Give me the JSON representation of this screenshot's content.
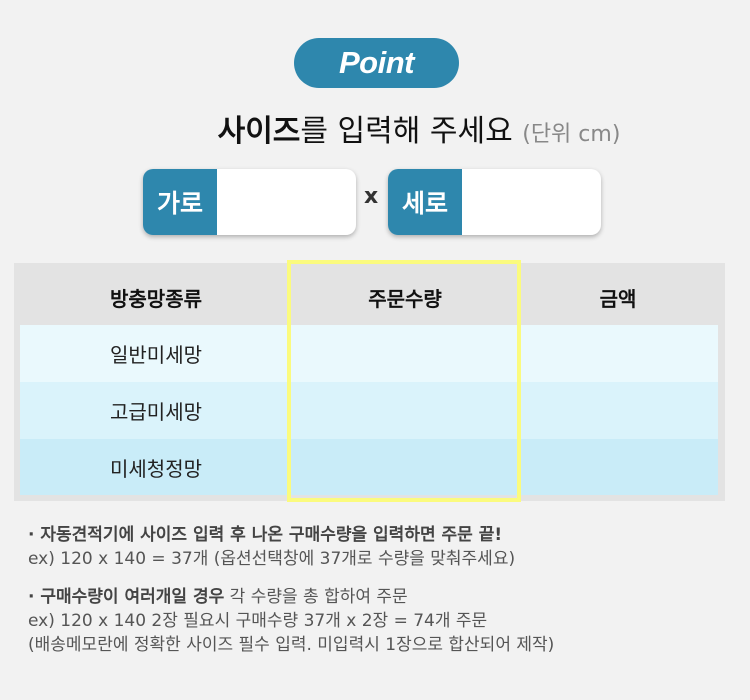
{
  "badge": "Point",
  "headline": {
    "bold": "사이즈",
    "rest": "를 입력해 주세요",
    "unit": "(단위 cm)"
  },
  "inputs": {
    "width_label": "가로",
    "width_value": "",
    "multiply": "x",
    "height_label": "세로",
    "height_value": ""
  },
  "table": {
    "headers": [
      "방충망종류",
      "주문수량",
      "금액"
    ],
    "rows": [
      {
        "type": "일반미세망",
        "qty": "",
        "price": ""
      },
      {
        "type": "고급미세망",
        "qty": "",
        "price": ""
      },
      {
        "type": "미세청정망",
        "qty": "",
        "price": ""
      }
    ]
  },
  "notes": {
    "note1": {
      "lead": "· 자동견적기에 사이즈 입력 후 나온 구매수량을 입력하면 주문 끝!",
      "example": "ex) 120 x 140 = 37개 (옵션선택창에 37개로 수량을 맞춰주세요)"
    },
    "note2": {
      "lead": "· 구매수량이 여러개일 경우",
      "lead_rest": " 각 수량을 총 합하여 주문",
      "example": "ex) 120 x 140 2장 필요시 구매수량 37개 x 2장 = 74개 주문",
      "memo": "(배송메모란에 정확한 사이즈 필수 입력. 미입력시 1장으로 합산되어 제작)"
    }
  },
  "colors": {
    "accent": "#2e87ad",
    "highlight": "#fbfb7e",
    "row1": "#eaf9fd",
    "row2": "#daf3fb",
    "row3": "#c9ecf8"
  }
}
